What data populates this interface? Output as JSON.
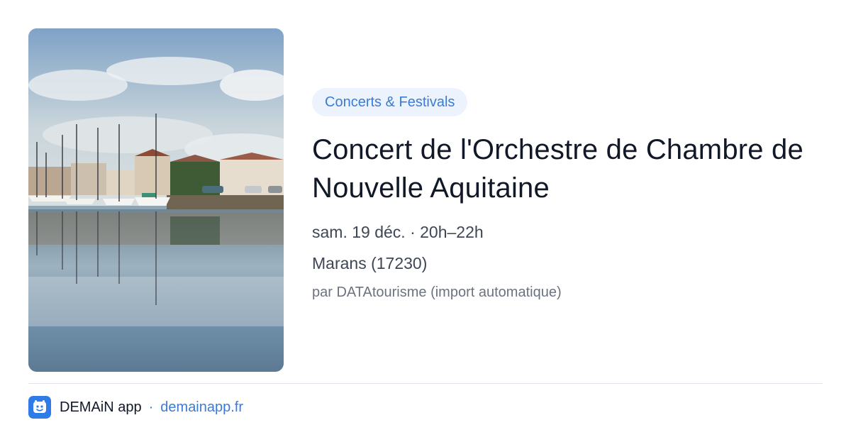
{
  "event": {
    "category": "Concerts & Festivals",
    "title": "Concert de l'Orchestre de Chambre de Nouvelle Aquitaine",
    "date_time": "sam. 19 déc. · 20h–22h",
    "location": "Marans (17230)",
    "source": "par DATAtourisme (import automatique)",
    "image_subject": "harbour-with-sailboats-photo"
  },
  "footer": {
    "app_name": "DEMAiN app",
    "separator": "·",
    "app_url": "demainapp.fr",
    "icon": "demain-app-logo-icon"
  },
  "colors": {
    "accent": "#3a7bd5",
    "category_bg": "#edf3fc",
    "title": "#111827",
    "meta": "#3f4654",
    "muted": "#6b7280",
    "app_icon_bg": "#2f7be8"
  }
}
